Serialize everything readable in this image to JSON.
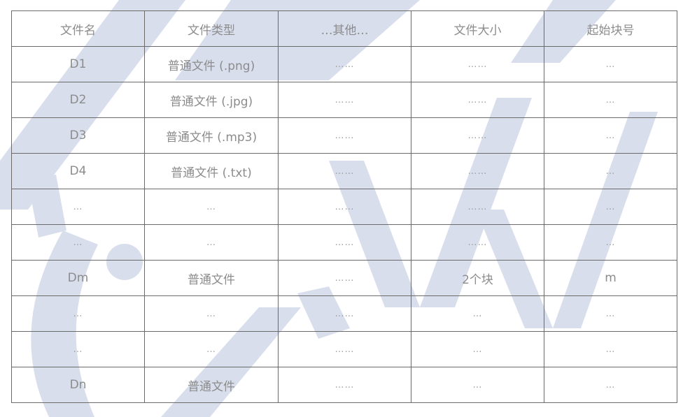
{
  "table": {
    "headers": [
      "文件名",
      "文件类型",
      "…其他…",
      "文件大小",
      "起始块号"
    ],
    "rows": [
      [
        "D1",
        "普通文件 (.png)",
        "……",
        "……",
        "…"
      ],
      [
        "D2",
        "普通文件 (.jpg)",
        "……",
        "……",
        "…"
      ],
      [
        "D3",
        "普通文件 (.mp3)",
        "……",
        "……",
        "…"
      ],
      [
        "D4",
        "普通文件 (.txt)",
        "……",
        "……",
        "…"
      ],
      [
        "…",
        "…",
        "……",
        "……",
        "…"
      ],
      [
        "…",
        "…",
        "……",
        "……",
        "…"
      ],
      [
        "Dm",
        "普通文件",
        "……",
        "2个块",
        "m"
      ],
      [
        "…",
        "…",
        "……",
        "…",
        "…"
      ],
      [
        "…",
        "…",
        "……",
        "…",
        "…"
      ],
      [
        "Dn",
        "普通文件",
        "……",
        "…",
        "…"
      ]
    ]
  },
  "colors": {
    "border": "#6a6a6a",
    "text": "#8c8c8c",
    "watermark": "#d6dcec"
  }
}
